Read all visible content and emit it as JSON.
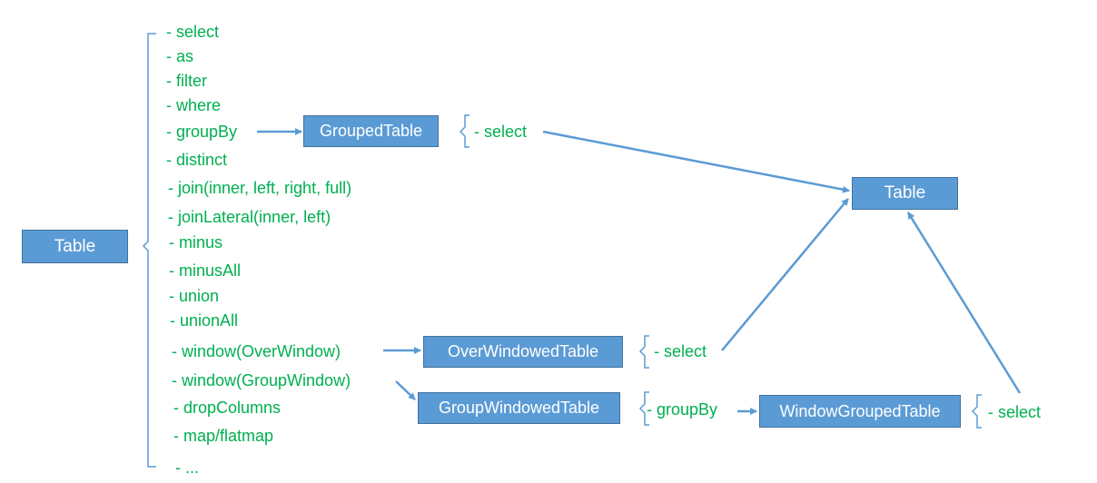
{
  "colors": {
    "box": "#5b9bd5",
    "box_border": "#41719c",
    "text": "#00b050",
    "line": "#5b9bd5"
  },
  "nodes": {
    "table_source": "Table",
    "grouped_table": "GroupedTable",
    "table_result": "Table",
    "over_windowed_table": "OverWindowedTable",
    "group_windowed_table": "GroupWindowedTable",
    "window_grouped_table": "WindowGroupedTable"
  },
  "table_operations": [
    "- select",
    "- as",
    "- filter",
    "- where",
    "- groupBy",
    "- distinct",
    "- join(inner, left, right, full)",
    "- joinLateral(inner, left)",
    "- minus",
    "- minusAll",
    "- union",
    "- unionAll",
    "- window(OverWindow)",
    "- window(GroupWindow)",
    "- dropColumns",
    "- map/flatmap",
    "- ..."
  ],
  "grouped_ops": "- select",
  "over_windowed_ops": "- select",
  "group_windowed_ops": "- groupBy",
  "window_grouped_ops": "- select"
}
